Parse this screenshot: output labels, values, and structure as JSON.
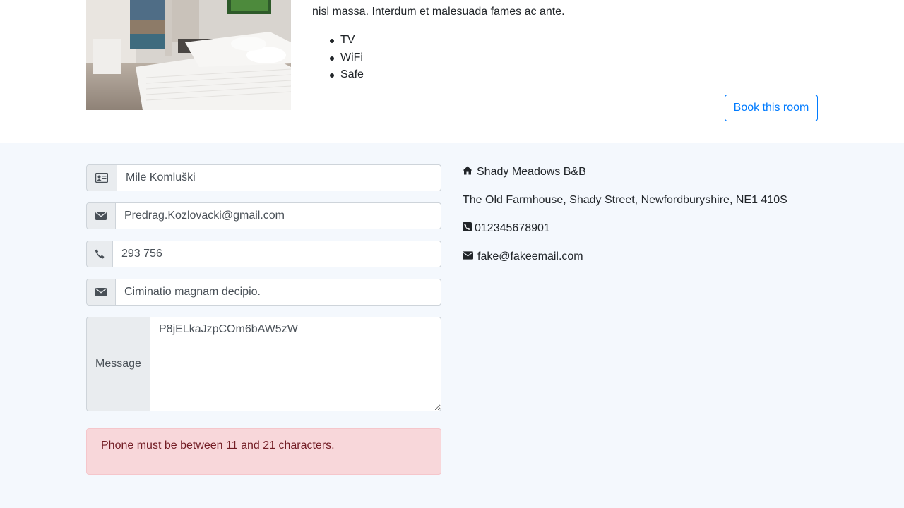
{
  "room": {
    "description_tail": "nisl massa. Interdum et malesuada fames ac ante.",
    "amenities": [
      "TV",
      "WiFi",
      "Safe"
    ],
    "book_label": "Book this room"
  },
  "form": {
    "name_value": "Mile Komluški",
    "email_value": "Predrag.Kozlovacki@gmail.com",
    "phone_value": "293 756",
    "subject_value": "Ciminatio magnam decipio.",
    "message_label": "Message",
    "message_value": "P8jELkaJzpCOm6bAW5zW"
  },
  "alert": {
    "text": "Phone must be between 11 and 21 characters."
  },
  "contact": {
    "name": "Shady Meadows B&B",
    "address": "The Old Farmhouse, Shady Street, Newfordburyshire, NE1 410S",
    "phone": "012345678901",
    "email": "fake@fakeemail.com"
  },
  "icons": {
    "name": "id-card-icon",
    "email": "envelope-icon",
    "phone": "phone-icon",
    "subject": "envelope-icon",
    "home": "home-icon"
  },
  "colors": {
    "accent": "#007bff",
    "page_bg": "#f4f8fd",
    "alert_bg": "#f8d7da",
    "alert_text": "#721c24"
  }
}
